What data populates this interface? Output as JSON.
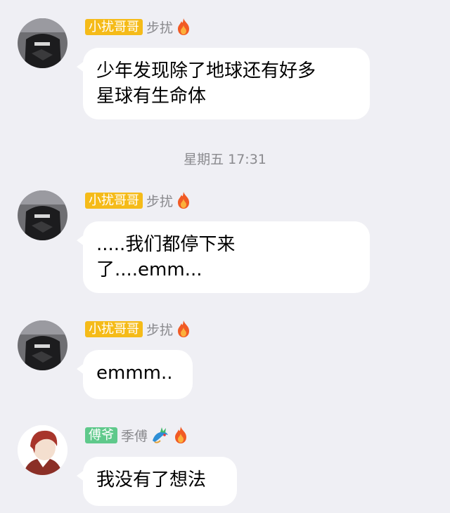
{
  "messages": [
    {
      "badge": "小扰哥哥",
      "nickname": "步扰",
      "avatar_icon": "avatar-dark-hoodie",
      "badge_color": "#f5bb19",
      "text_lines": [
        "少年发现除了地球还有好多",
        "星球有生命体"
      ]
    },
    {
      "badge": "小扰哥哥",
      "nickname": "步扰",
      "avatar_icon": "avatar-dark-hoodie",
      "badge_color": "#f5bb19",
      "text_lines": [
        ".....我们都停下来",
        "了....emm..."
      ]
    },
    {
      "badge": "小扰哥哥",
      "nickname": "步扰",
      "avatar_icon": "avatar-dark-hoodie",
      "badge_color": "#f5bb19",
      "text_lines": [
        "emmm.."
      ]
    },
    {
      "badge": "傅爷",
      "nickname": "季傅",
      "avatar_icon": "avatar-anime-red-hair",
      "badge_color": "#5fc98b",
      "text_lines": [
        "我没有了想法"
      ]
    }
  ],
  "timestamp": "星期五 17:31",
  "colors": {
    "background": "#efeff4",
    "bubble": "#ffffff",
    "gray_text": "#8a8a8e"
  }
}
